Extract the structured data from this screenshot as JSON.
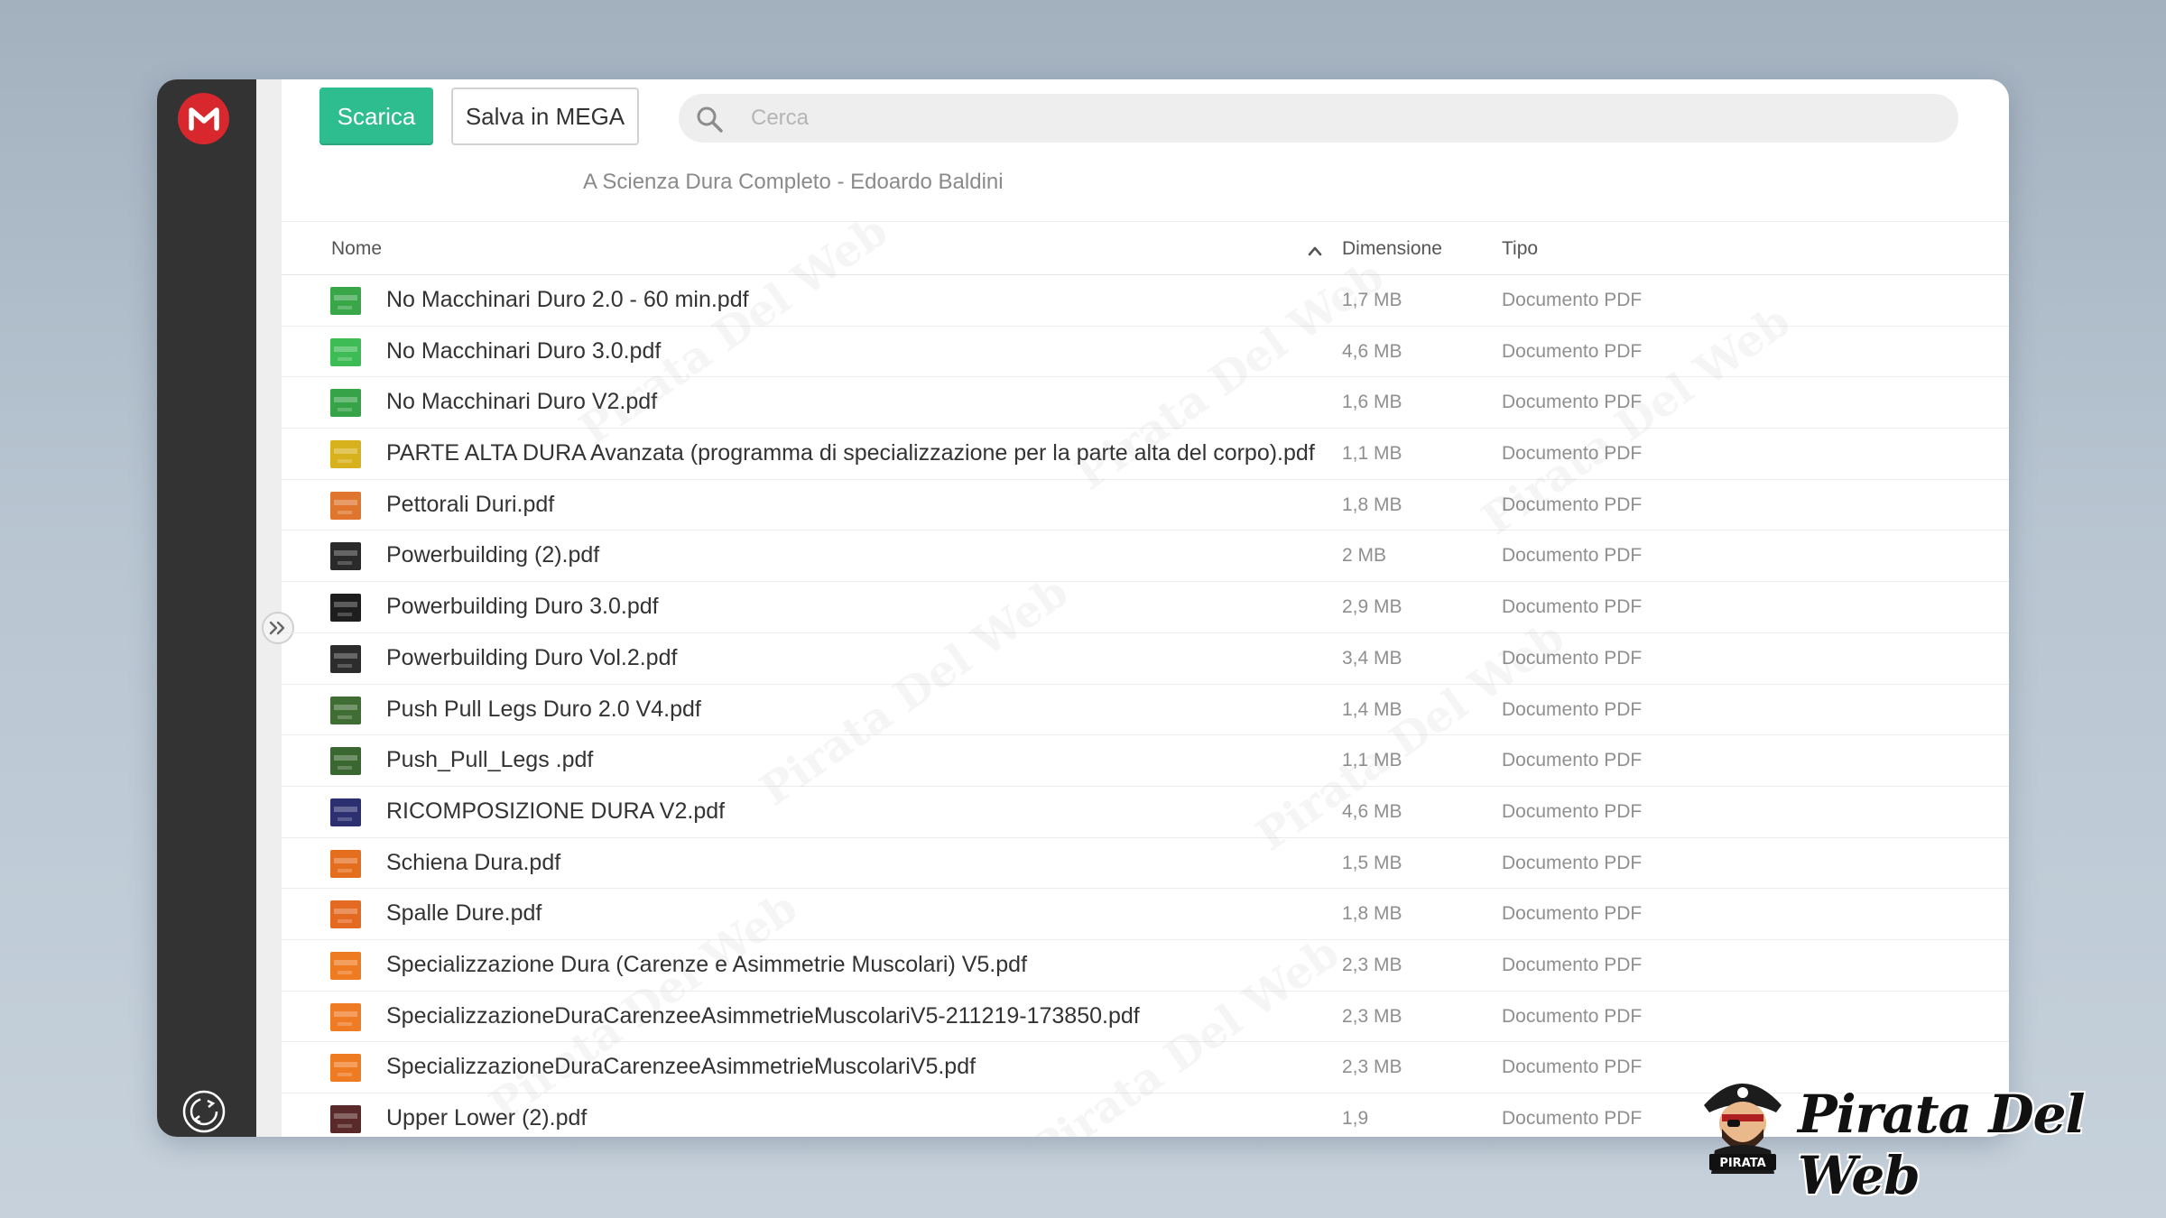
{
  "toolbar": {
    "download_label": "Scarica",
    "save_label": "Salva in MEGA"
  },
  "search": {
    "placeholder": "Cerca"
  },
  "folder_title": "A Scienza Dura Completo - Edoardo Baldini",
  "table": {
    "columns": {
      "name": "Nome",
      "size": "Dimensione",
      "type": "Tipo"
    },
    "rows": [
      {
        "name": "No Macchinari Duro 2.0 - 60 min.pdf",
        "size": "1,7 MB",
        "type": "Documento PDF",
        "thumb": "#3aa64a"
      },
      {
        "name": "No Macchinari Duro 3.0.pdf",
        "size": "4,6 MB",
        "type": "Documento PDF",
        "thumb": "#3dbb55"
      },
      {
        "name": "No Macchinari Duro V2.pdf",
        "size": "1,6 MB",
        "type": "Documento PDF",
        "thumb": "#36a348"
      },
      {
        "name": "PARTE ALTA DURA Avanzata (programma di specializzazione per la parte alta del corpo).pdf",
        "size": "1,1 MB",
        "type": "Documento PDF",
        "thumb": "#d8b21c"
      },
      {
        "name": "Pettorali Duri.pdf",
        "size": "1,8 MB",
        "type": "Documento PDF",
        "thumb": "#e0762e"
      },
      {
        "name": "Powerbuilding (2).pdf",
        "size": "2 MB",
        "type": "Documento PDF",
        "thumb": "#2a2a2a"
      },
      {
        "name": "Powerbuilding Duro 3.0.pdf",
        "size": "2,9 MB",
        "type": "Documento PDF",
        "thumb": "#1e1e1e"
      },
      {
        "name": "Powerbuilding Duro Vol.2.pdf",
        "size": "3,4 MB",
        "type": "Documento PDF",
        "thumb": "#2c2c2c"
      },
      {
        "name": "Push Pull Legs Duro 2.0 V4.pdf",
        "size": "1,4 MB",
        "type": "Documento PDF",
        "thumb": "#3f6d33"
      },
      {
        "name": "Push_Pull_Legs .pdf",
        "size": "1,1 MB",
        "type": "Documento PDF",
        "thumb": "#3a6630"
      },
      {
        "name": "RICOMPOSIZIONE DURA V2.pdf",
        "size": "4,6 MB",
        "type": "Documento PDF",
        "thumb": "#2c2f70"
      },
      {
        "name": "Schiena Dura.pdf",
        "size": "1,5 MB",
        "type": "Documento PDF",
        "thumb": "#e46e1e"
      },
      {
        "name": "Spalle Dure.pdf",
        "size": "1,8 MB",
        "type": "Documento PDF",
        "thumb": "#e46a22"
      },
      {
        "name": "Specializzazione Dura (Carenze e Asimmetrie Muscolari) V5.pdf",
        "size": "2,3 MB",
        "type": "Documento PDF",
        "thumb": "#ee7a22"
      },
      {
        "name": "SpecializzazioneDuraCarenzeeAsimmetrieMuscolariV5-211219-173850.pdf",
        "size": "2,3 MB",
        "type": "Documento PDF",
        "thumb": "#ef7b24"
      },
      {
        "name": "SpecializzazioneDuraCarenzeeAsimmetrieMuscolariV5.pdf",
        "size": "2,3 MB",
        "type": "Documento PDF",
        "thumb": "#ee7a22"
      },
      {
        "name": "Upper Lower (2).pdf",
        "size": "1,9",
        "type": "Documento PDF",
        "thumb": "#5a2a2a"
      }
    ]
  },
  "watermark": {
    "text": "Pirata Del Web",
    "mascot_label": "PIRATA"
  },
  "colors": {
    "accent": "#2ebd8e",
    "mega_red": "#d9272e",
    "sidebar": "#333333"
  },
  "icons": {
    "logo": "mega-logo-icon",
    "search": "search-icon",
    "expand": "double-chevron-right-icon",
    "sort": "chevron-up-icon",
    "sync": "sync-icon",
    "file": "pdf-thumbnail-icon"
  }
}
